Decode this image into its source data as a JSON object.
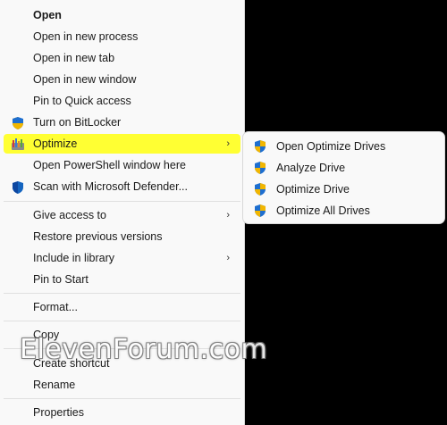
{
  "context_menu": {
    "items": [
      {
        "label": "Open"
      },
      {
        "label": "Open in new process"
      },
      {
        "label": "Open in new tab"
      },
      {
        "label": "Open in new window"
      },
      {
        "label": "Pin to Quick access"
      },
      {
        "label": "Turn on BitLocker",
        "icon": "shield-icon"
      },
      {
        "label": "Optimize",
        "icon": "defrag-icon"
      },
      {
        "label": "Open PowerShell window here"
      },
      {
        "label": "Scan with Microsoft Defender...",
        "icon": "defender-shield-icon"
      },
      {
        "label": "Give access to"
      },
      {
        "label": "Restore previous versions"
      },
      {
        "label": "Include in library"
      },
      {
        "label": "Pin to Start"
      },
      {
        "label": "Format..."
      },
      {
        "label": "Copy"
      },
      {
        "label": "Create shortcut"
      },
      {
        "label": "Rename"
      },
      {
        "label": "Properties"
      }
    ],
    "highlight_color": "#ffff33"
  },
  "submenu": {
    "items": [
      {
        "label": "Open Optimize Drives",
        "icon": "uac-shield-icon"
      },
      {
        "label": "Analyze Drive",
        "icon": "uac-shield-icon"
      },
      {
        "label": "Optimize Drive",
        "icon": "uac-shield-icon"
      },
      {
        "label": "Optimize All Drives",
        "icon": "uac-shield-icon"
      }
    ]
  },
  "watermark": "ElevenForum.com"
}
